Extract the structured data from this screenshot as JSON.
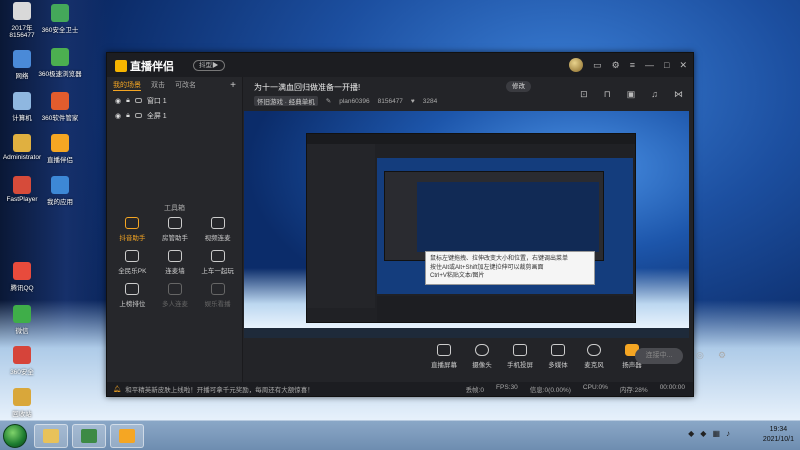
{
  "desktop": {
    "icons": [
      {
        "label": "2017年\n8156477",
        "color": "#d9d9d9"
      },
      {
        "label": "360安全卫士",
        "color": "#44a85a"
      },
      {
        "label": "网络",
        "color": "#4a8ad8"
      },
      {
        "label": "360极速浏览器",
        "color": "#4caf50"
      },
      {
        "label": "计算机",
        "color": "#8fb7e0"
      },
      {
        "label": "360软件管家",
        "color": "#e25c2d"
      },
      {
        "label": "Administrator",
        "color": "#e0b040"
      },
      {
        "label": "直播伴侣",
        "color": "#f5a623"
      },
      {
        "label": "FastPlayer",
        "color": "#d64b3a"
      },
      {
        "label": "我的应用",
        "color": "#3d88d6"
      },
      {
        "label": "腾讯QQ",
        "color": "#e84b3c"
      },
      {
        "label": "微信",
        "color": "#3fae49"
      },
      {
        "label": "360安全",
        "color": "#d6443a"
      },
      {
        "label": "回收站",
        "color": "#d9a73a"
      }
    ]
  },
  "app": {
    "logo": "直播伴侣",
    "version_label": "抖型▶",
    "tabs": [
      "我的场景",
      "双击",
      "可改名"
    ],
    "add_label": "+",
    "scenes": [
      {
        "name": "窗口 1"
      },
      {
        "name": "全屏 1"
      }
    ],
    "toolbox_title": "工具箱",
    "tools": [
      {
        "label": "抖音助手",
        "state": "on"
      },
      {
        "label": "房管助手",
        "state": "normal"
      },
      {
        "label": "视频连麦",
        "state": "normal"
      },
      {
        "label": "全民乐PK",
        "state": "normal"
      },
      {
        "label": "连麦墙",
        "state": "normal"
      },
      {
        "label": "上车一起玩",
        "state": "normal"
      },
      {
        "label": "上榜排位",
        "state": "normal"
      },
      {
        "label": "多人连麦",
        "state": "dim"
      },
      {
        "label": "娱乐看播",
        "state": "dim"
      }
    ],
    "stream": {
      "title": "为十一满血回归做准备一开播!",
      "edit_label": "修改",
      "category": "怀旧游戏 · 经典单机",
      "user": "plan60396",
      "uid": "8156477",
      "fans": "3284"
    },
    "tooltip": "鼠标左键拖拽、拉伸改变大小和位置，右键调出菜单\n按住Alt或Alt+Shift加左键拉伸可以裁剪画面\nCtrl+V粘贴文本/图片",
    "controls": [
      {
        "label": "直播屏幕",
        "icon": "screen-icon"
      },
      {
        "label": "摄像头",
        "icon": "camera-icon"
      },
      {
        "label": "手机投屏",
        "icon": "phone-cast-icon"
      },
      {
        "label": "多媒体",
        "icon": "media-icon"
      },
      {
        "label": "麦克风",
        "icon": "mic-icon"
      },
      {
        "label": "扬声器",
        "icon": "speaker-icon"
      }
    ],
    "start_label": "连接中...",
    "status": {
      "notice": "和平精英新皮肤上线啦！开播可拿千元奖励，每周还有大额惊喜！",
      "stats": [
        "丢帧:0",
        "FPS:30",
        "信息:0(0.00%)",
        "CPU:0%",
        "内存:28%",
        "00:00:00"
      ]
    },
    "accent": "#f5a623"
  },
  "taskbar": {
    "time": "19:34",
    "date": "2021/10/1"
  }
}
